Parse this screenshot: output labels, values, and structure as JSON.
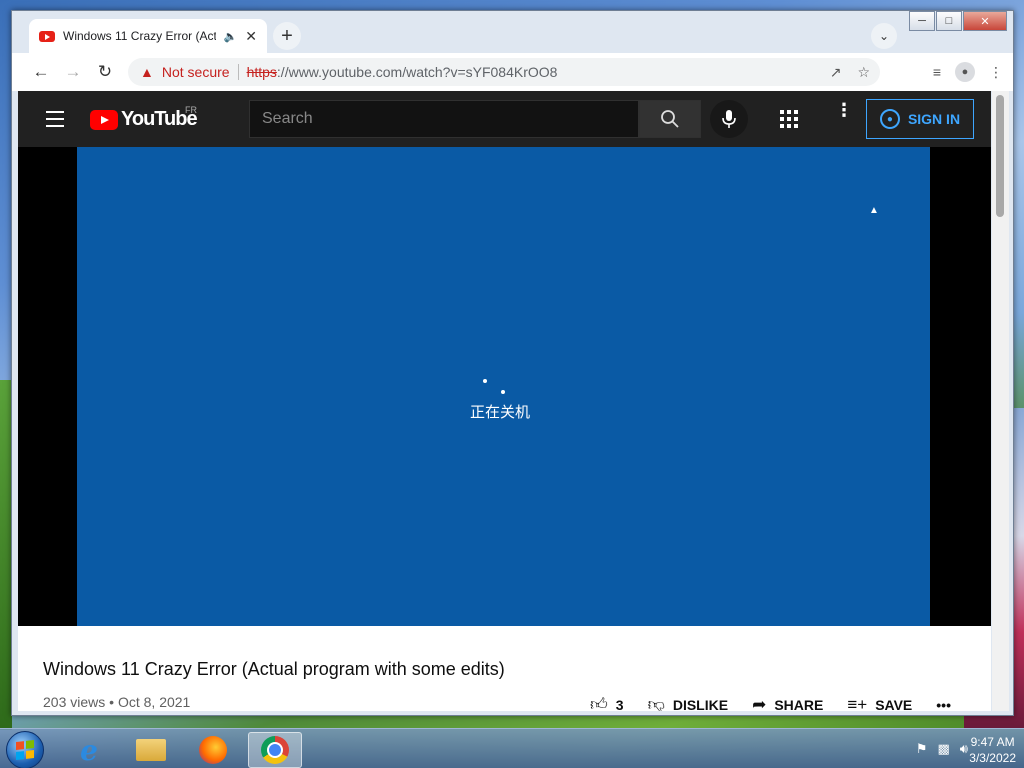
{
  "browser": {
    "tab": {
      "title": "Windows 11 Crazy Error (Act",
      "audio_icon": "speaker-icon"
    },
    "address": {
      "security_label": "Not secure",
      "url_scheme": "https",
      "url_rest": "://www.youtube.com/watch?v=sYF084KrOO8"
    },
    "window_controls": [
      "minimize",
      "maximize",
      "close"
    ]
  },
  "youtube": {
    "region": "FR",
    "logo_text": "YouTube",
    "search_placeholder": "Search",
    "sign_in_label": "SIGN IN"
  },
  "video": {
    "overlay_text": "正在关机",
    "title": "Windows 11 Crazy Error (Actual program with some edits)",
    "views": "203 views",
    "separator": "•",
    "date": "Oct 8, 2021",
    "actions": {
      "like_count": "3",
      "dislike_label": "DISLIKE",
      "share_label": "SHARE",
      "save_label": "SAVE",
      "more_label": "•••"
    }
  },
  "taskbar": {
    "clock_time": "9:47 AM",
    "clock_date": "3/3/2022",
    "apps": [
      "internet-explorer",
      "file-explorer",
      "firefox",
      "chrome"
    ]
  },
  "colors": {
    "video_bg": "#0a5aa5",
    "yt_header": "#212121",
    "accent_blue": "#3ea6ff",
    "warning_red": "#c5221f"
  }
}
